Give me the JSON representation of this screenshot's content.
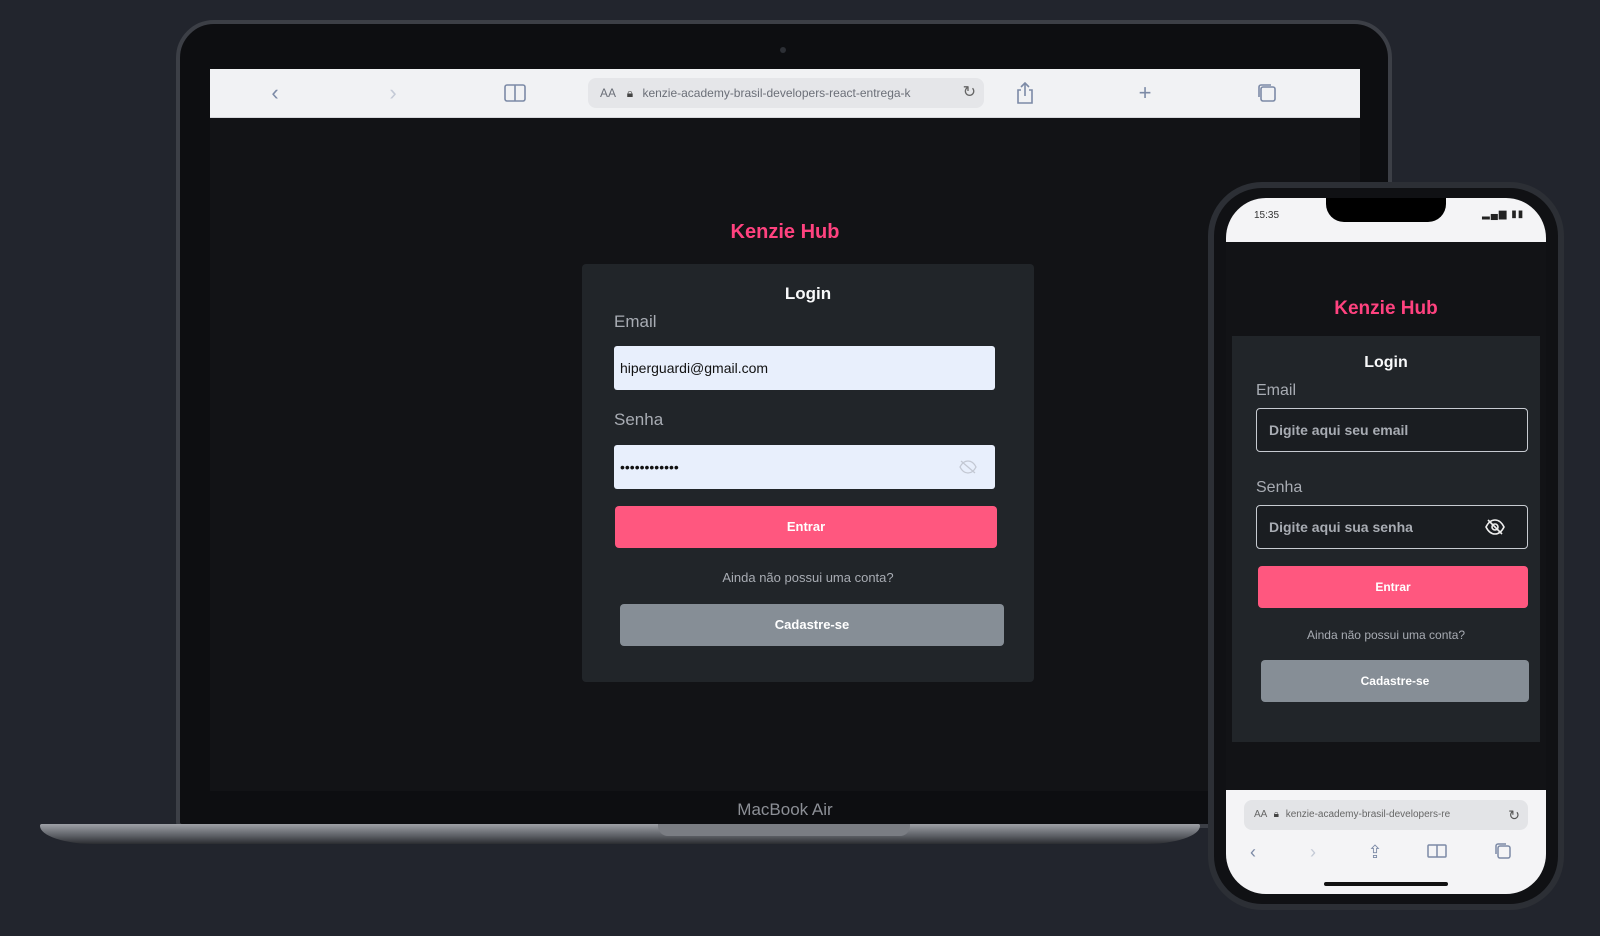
{
  "laptop": {
    "address": "kenzie-academy-brasil-developers-react-entrega-k",
    "aa": "AA",
    "brand": "Kenzie Hub",
    "form": {
      "title": "Login",
      "email_label": "Email",
      "email_value": "hiperguardi@gmail.com",
      "password_label": "Senha",
      "password_value": "••••••••••••",
      "submit_label": "Entrar",
      "question": "Ainda não possui uma conta?",
      "register_label": "Cadastre-se"
    },
    "model_label": "MacBook Air"
  },
  "phone": {
    "time": "15:35",
    "signal": "▂▄▆ ▮▮",
    "brand": "Kenzie Hub",
    "form": {
      "title": "Login",
      "email_label": "Email",
      "email_placeholder": "Digite aqui seu email",
      "password_label": "Senha",
      "password_placeholder": "Digite aqui sua senha",
      "submit_label": "Entrar",
      "question": "Ainda não possui uma conta?",
      "register_label": "Cadastre-se"
    },
    "address": "kenzie-academy-brasil-developers-re",
    "aa": "AA"
  },
  "colors": {
    "brand": "#ff427f",
    "primary_button": "#ff577f",
    "secondary_button": "#868e96",
    "card": "#212529",
    "background": "#22252d"
  },
  "icons": [
    "back-icon",
    "forward-icon",
    "sidebar-icon",
    "lock-icon",
    "reload-icon",
    "share-icon",
    "plus-icon",
    "tabs-icon",
    "eye-off-icon"
  ]
}
